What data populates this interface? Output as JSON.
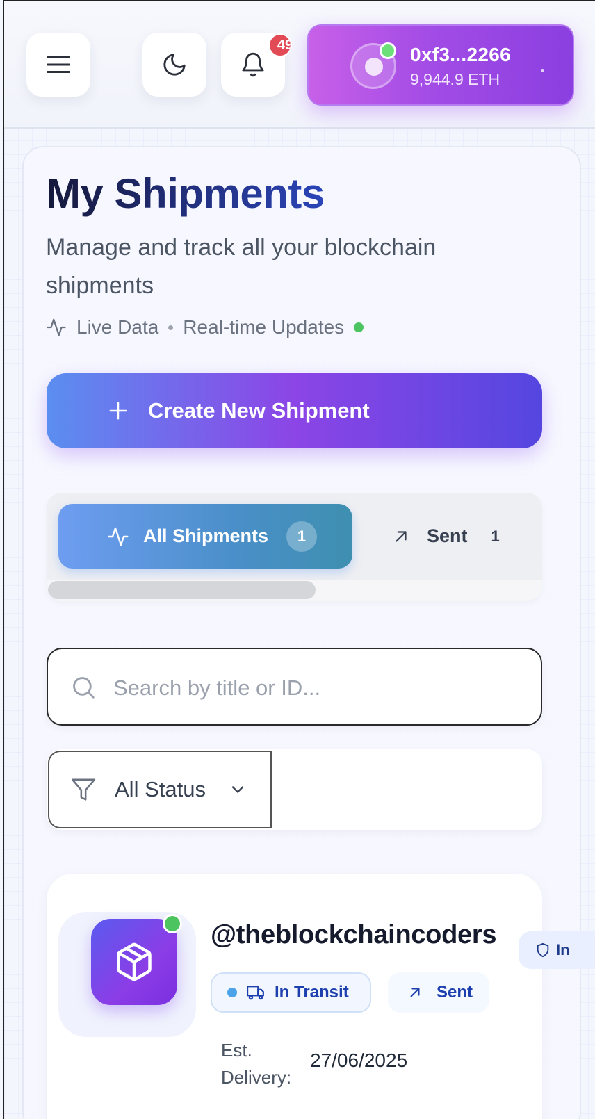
{
  "header": {
    "notification_count": "49",
    "wallet": {
      "address": "0xf3...2266",
      "balance": "9,944.9 ETH"
    }
  },
  "page": {
    "title": "My Shipments",
    "subtitle": "Manage and track all your blockchain shipments",
    "live_data_label": "Live Data",
    "realtime_label": "Real-time Updates"
  },
  "create_button": {
    "label": "Create New Shipment"
  },
  "tabs": [
    {
      "label": "All Shipments",
      "count": "1",
      "active": true
    },
    {
      "label": "Sent",
      "count": "1",
      "active": false
    }
  ],
  "search": {
    "placeholder": "Search by title or ID..."
  },
  "filter": {
    "selected": "All Status"
  },
  "shipments": [
    {
      "title": "@theblockchaincoders",
      "security_badge": "In",
      "status": "In Transit",
      "direction": "Sent",
      "delivery_label": "Est. Delivery:",
      "delivery_date": "27/06/2025"
    }
  ],
  "colors": {
    "accent_purple": "#8b3fe0",
    "accent_blue": "#5b8ef0",
    "online_green": "#4cc460",
    "badge_red": "#e24a55"
  }
}
